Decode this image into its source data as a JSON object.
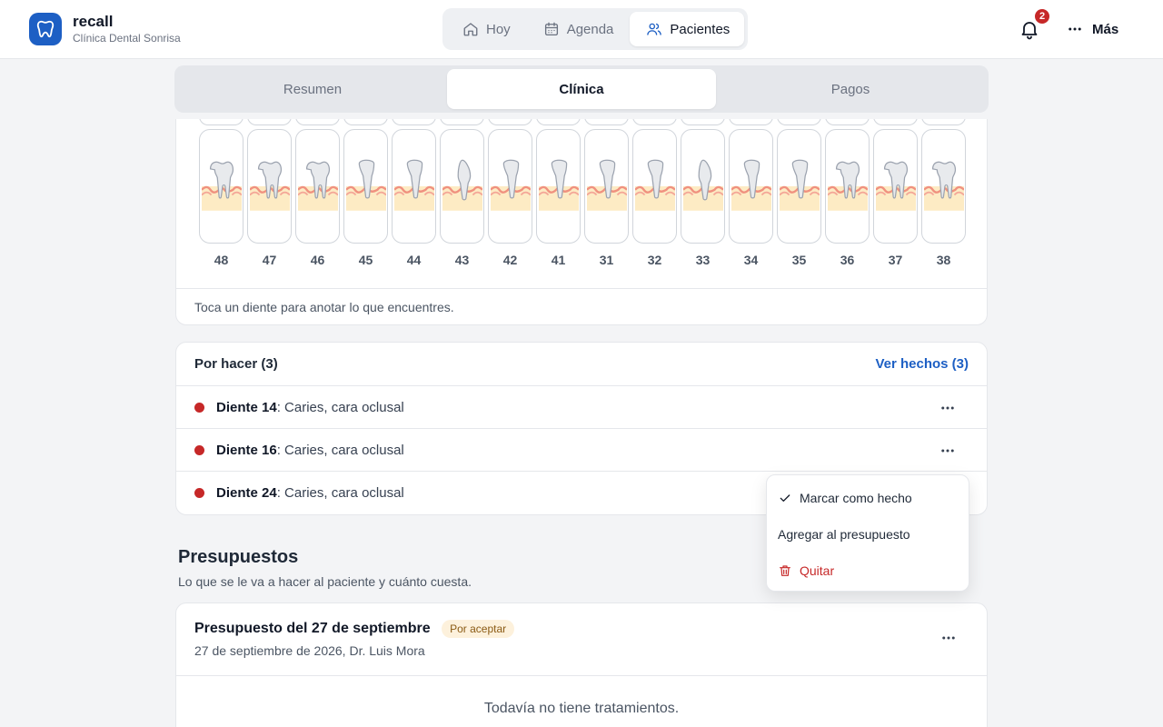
{
  "app": {
    "name": "recall",
    "clinic": "Clínica Dental Sonrisa"
  },
  "nav": {
    "items": [
      {
        "label": "Hoy",
        "icon": "home-icon"
      },
      {
        "label": "Agenda",
        "icon": "calendar-icon"
      },
      {
        "label": "Pacientes",
        "icon": "users-icon"
      }
    ],
    "active": "Pacientes"
  },
  "header": {
    "notifications_count": "2",
    "more_label": "Más"
  },
  "tabs": {
    "items": [
      "Resumen",
      "Clínica",
      "Pagos"
    ],
    "active": "Clínica"
  },
  "teeth": {
    "numbers": [
      "48",
      "47",
      "46",
      "45",
      "44",
      "43",
      "42",
      "41",
      "31",
      "32",
      "33",
      "34",
      "35",
      "36",
      "37",
      "38"
    ],
    "hint": "Toca un diente para anotar lo que encuentres."
  },
  "todo": {
    "title": "Por hacer (3)",
    "done_link": "Ver hechos (3)",
    "items": [
      {
        "tooth": "Diente 14",
        "desc": ": Caries, cara oclusal"
      },
      {
        "tooth": "Diente 16",
        "desc": ": Caries, cara oclusal"
      },
      {
        "tooth": "Diente 24",
        "desc": ": Caries, cara oclusal"
      }
    ]
  },
  "menu": {
    "items": [
      {
        "label": "Marcar como hecho",
        "icon": "check-icon"
      },
      {
        "label": "Agregar al presupuesto",
        "icon": ""
      },
      {
        "label": "Quitar",
        "icon": "trash-icon"
      }
    ]
  },
  "budgets": {
    "title": "Presupuestos",
    "subtitle": "Lo que se le va a hacer al paciente y cuánto cuesta.",
    "card": {
      "title": "Presupuesto del 27 de septiembre",
      "status": "Por aceptar",
      "meta": "27 de septiembre de 2026, Dr. Luis Mora",
      "empty": "Todavía no tiene tratamientos."
    }
  },
  "colors": {
    "primary": "#1d5fc4",
    "danger": "#c62828",
    "pending_bg": "#fdf1dc"
  }
}
